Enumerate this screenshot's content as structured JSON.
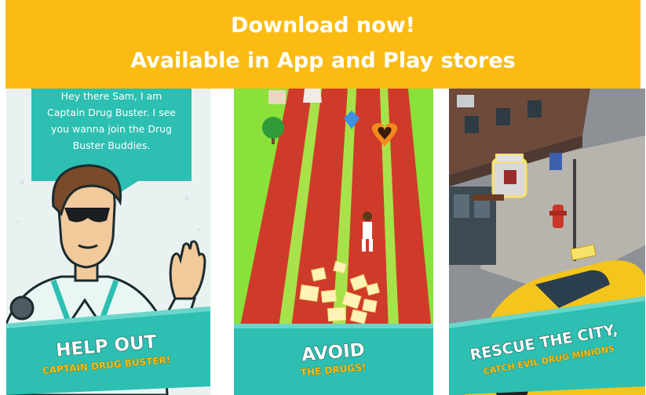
{
  "banner": {
    "line1": "Download now!",
    "line2": "Available in App and Play stores",
    "color": "#fbbb12"
  },
  "screens": [
    {
      "speech_bubble": [
        "Hey there Sam, I am",
        "Captain Drug Buster. I see",
        "you wanna join the Drug",
        "Buster Buddies."
      ],
      "title": "HELP OUT",
      "subtitle": "CAPTAIN DRUG BUSTER!"
    },
    {
      "title": "AVOID",
      "subtitle": "THE DRUGS!"
    },
    {
      "title": "RESCUE THE CITY,",
      "subtitle": "CATCH EVIL DRUG MINIONS"
    }
  ],
  "colors": {
    "teal": "#2dbfb1",
    "track_red": "#cf3b2a",
    "grass_green": "#8ae13a",
    "taxi_yellow": "#f4c51c",
    "subtitle_yellow": "#f6c21a"
  }
}
